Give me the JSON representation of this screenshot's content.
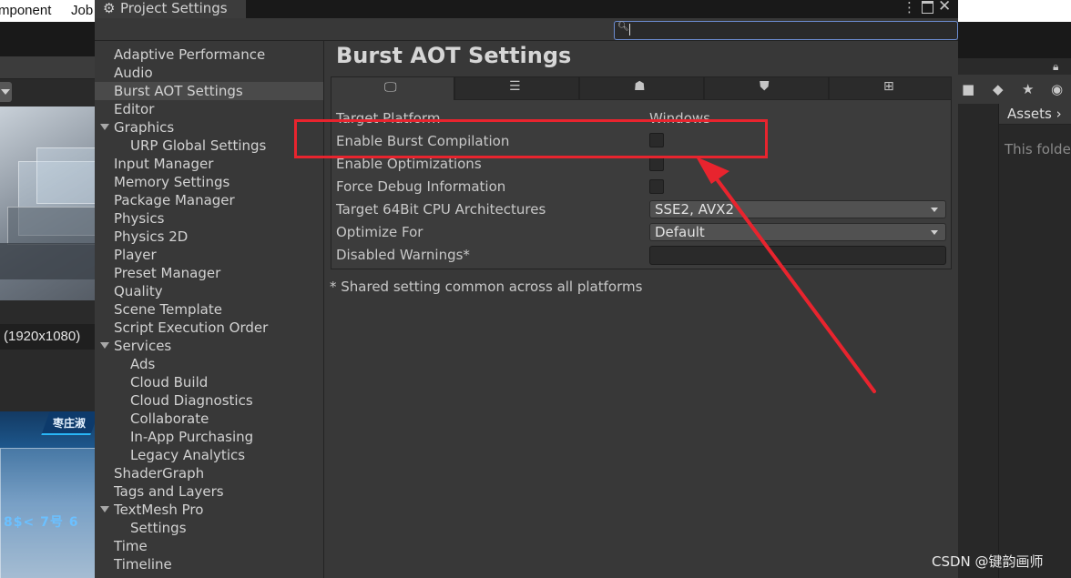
{
  "background": {
    "menu_items": [
      "mponent",
      "Job"
    ],
    "game_view_resolution": "(1920x1080)",
    "scene_title": "枣庄淑",
    "scene_numbers": "8$< 7号 6",
    "project_panel": {
      "assets_label": "Assets",
      "empty_folder_text": "This folder"
    }
  },
  "window": {
    "title": "Project Settings",
    "title_icon": "gear-icon",
    "controls": [
      "more-icon",
      "maximize-icon",
      "close-icon"
    ],
    "search": {
      "value": "",
      "placeholder": ""
    }
  },
  "sidebar": {
    "selected": "Burst AOT Settings",
    "items": [
      {
        "label": "Adaptive Performance",
        "indent": 0
      },
      {
        "label": "Audio",
        "indent": 0
      },
      {
        "label": "Burst AOT Settings",
        "indent": 0
      },
      {
        "label": "Editor",
        "indent": 0
      },
      {
        "label": "Graphics",
        "indent": 0,
        "expanded": true
      },
      {
        "label": "URP Global Settings",
        "indent": 1
      },
      {
        "label": "Input Manager",
        "indent": 0
      },
      {
        "label": "Memory Settings",
        "indent": 0
      },
      {
        "label": "Package Manager",
        "indent": 0
      },
      {
        "label": "Physics",
        "indent": 0
      },
      {
        "label": "Physics 2D",
        "indent": 0
      },
      {
        "label": "Player",
        "indent": 0
      },
      {
        "label": "Preset Manager",
        "indent": 0
      },
      {
        "label": "Quality",
        "indent": 0
      },
      {
        "label": "Scene Template",
        "indent": 0
      },
      {
        "label": "Script Execution Order",
        "indent": 0
      },
      {
        "label": "Services",
        "indent": 0,
        "expanded": true
      },
      {
        "label": "Ads",
        "indent": 1
      },
      {
        "label": "Cloud Build",
        "indent": 1
      },
      {
        "label": "Cloud Diagnostics",
        "indent": 1
      },
      {
        "label": "Collaborate",
        "indent": 1
      },
      {
        "label": "In-App Purchasing",
        "indent": 1
      },
      {
        "label": "Legacy Analytics",
        "indent": 1
      },
      {
        "label": "ShaderGraph",
        "indent": 0
      },
      {
        "label": "Tags and Layers",
        "indent": 0
      },
      {
        "label": "TextMesh Pro",
        "indent": 0,
        "expanded": true
      },
      {
        "label": "Settings",
        "indent": 1
      },
      {
        "label": "Time",
        "indent": 0
      },
      {
        "label": "Timeline",
        "indent": 0
      }
    ]
  },
  "main": {
    "title": "Burst AOT Settings",
    "platform_tabs": [
      {
        "icon": "desktop-icon",
        "active": true
      },
      {
        "icon": "server-icon",
        "active": false
      },
      {
        "icon": "android-icon",
        "active": false
      },
      {
        "icon": "html5-icon",
        "active": false
      },
      {
        "icon": "windows-icon",
        "active": false
      }
    ],
    "rows": {
      "target_platform": {
        "label": "Target Platform",
        "value": "Windows"
      },
      "enable_burst": {
        "label": "Enable Burst Compilation",
        "checked": false
      },
      "enable_optimizations": {
        "label": "Enable Optimizations",
        "checked": false
      },
      "force_debug": {
        "label": "Force Debug Information",
        "checked": false
      },
      "target_cpu": {
        "label": "Target 64Bit CPU Architectures",
        "value": "SSE2, AVX2"
      },
      "optimize_for": {
        "label": "Optimize For",
        "value": "Default"
      },
      "disabled_warnings": {
        "label": "Disabled Warnings*",
        "value": ""
      }
    },
    "footnote": "* Shared setting common across all platforms"
  },
  "annotation": {
    "color": "#e8242e"
  },
  "watermark": "CSDN @键韵画师"
}
